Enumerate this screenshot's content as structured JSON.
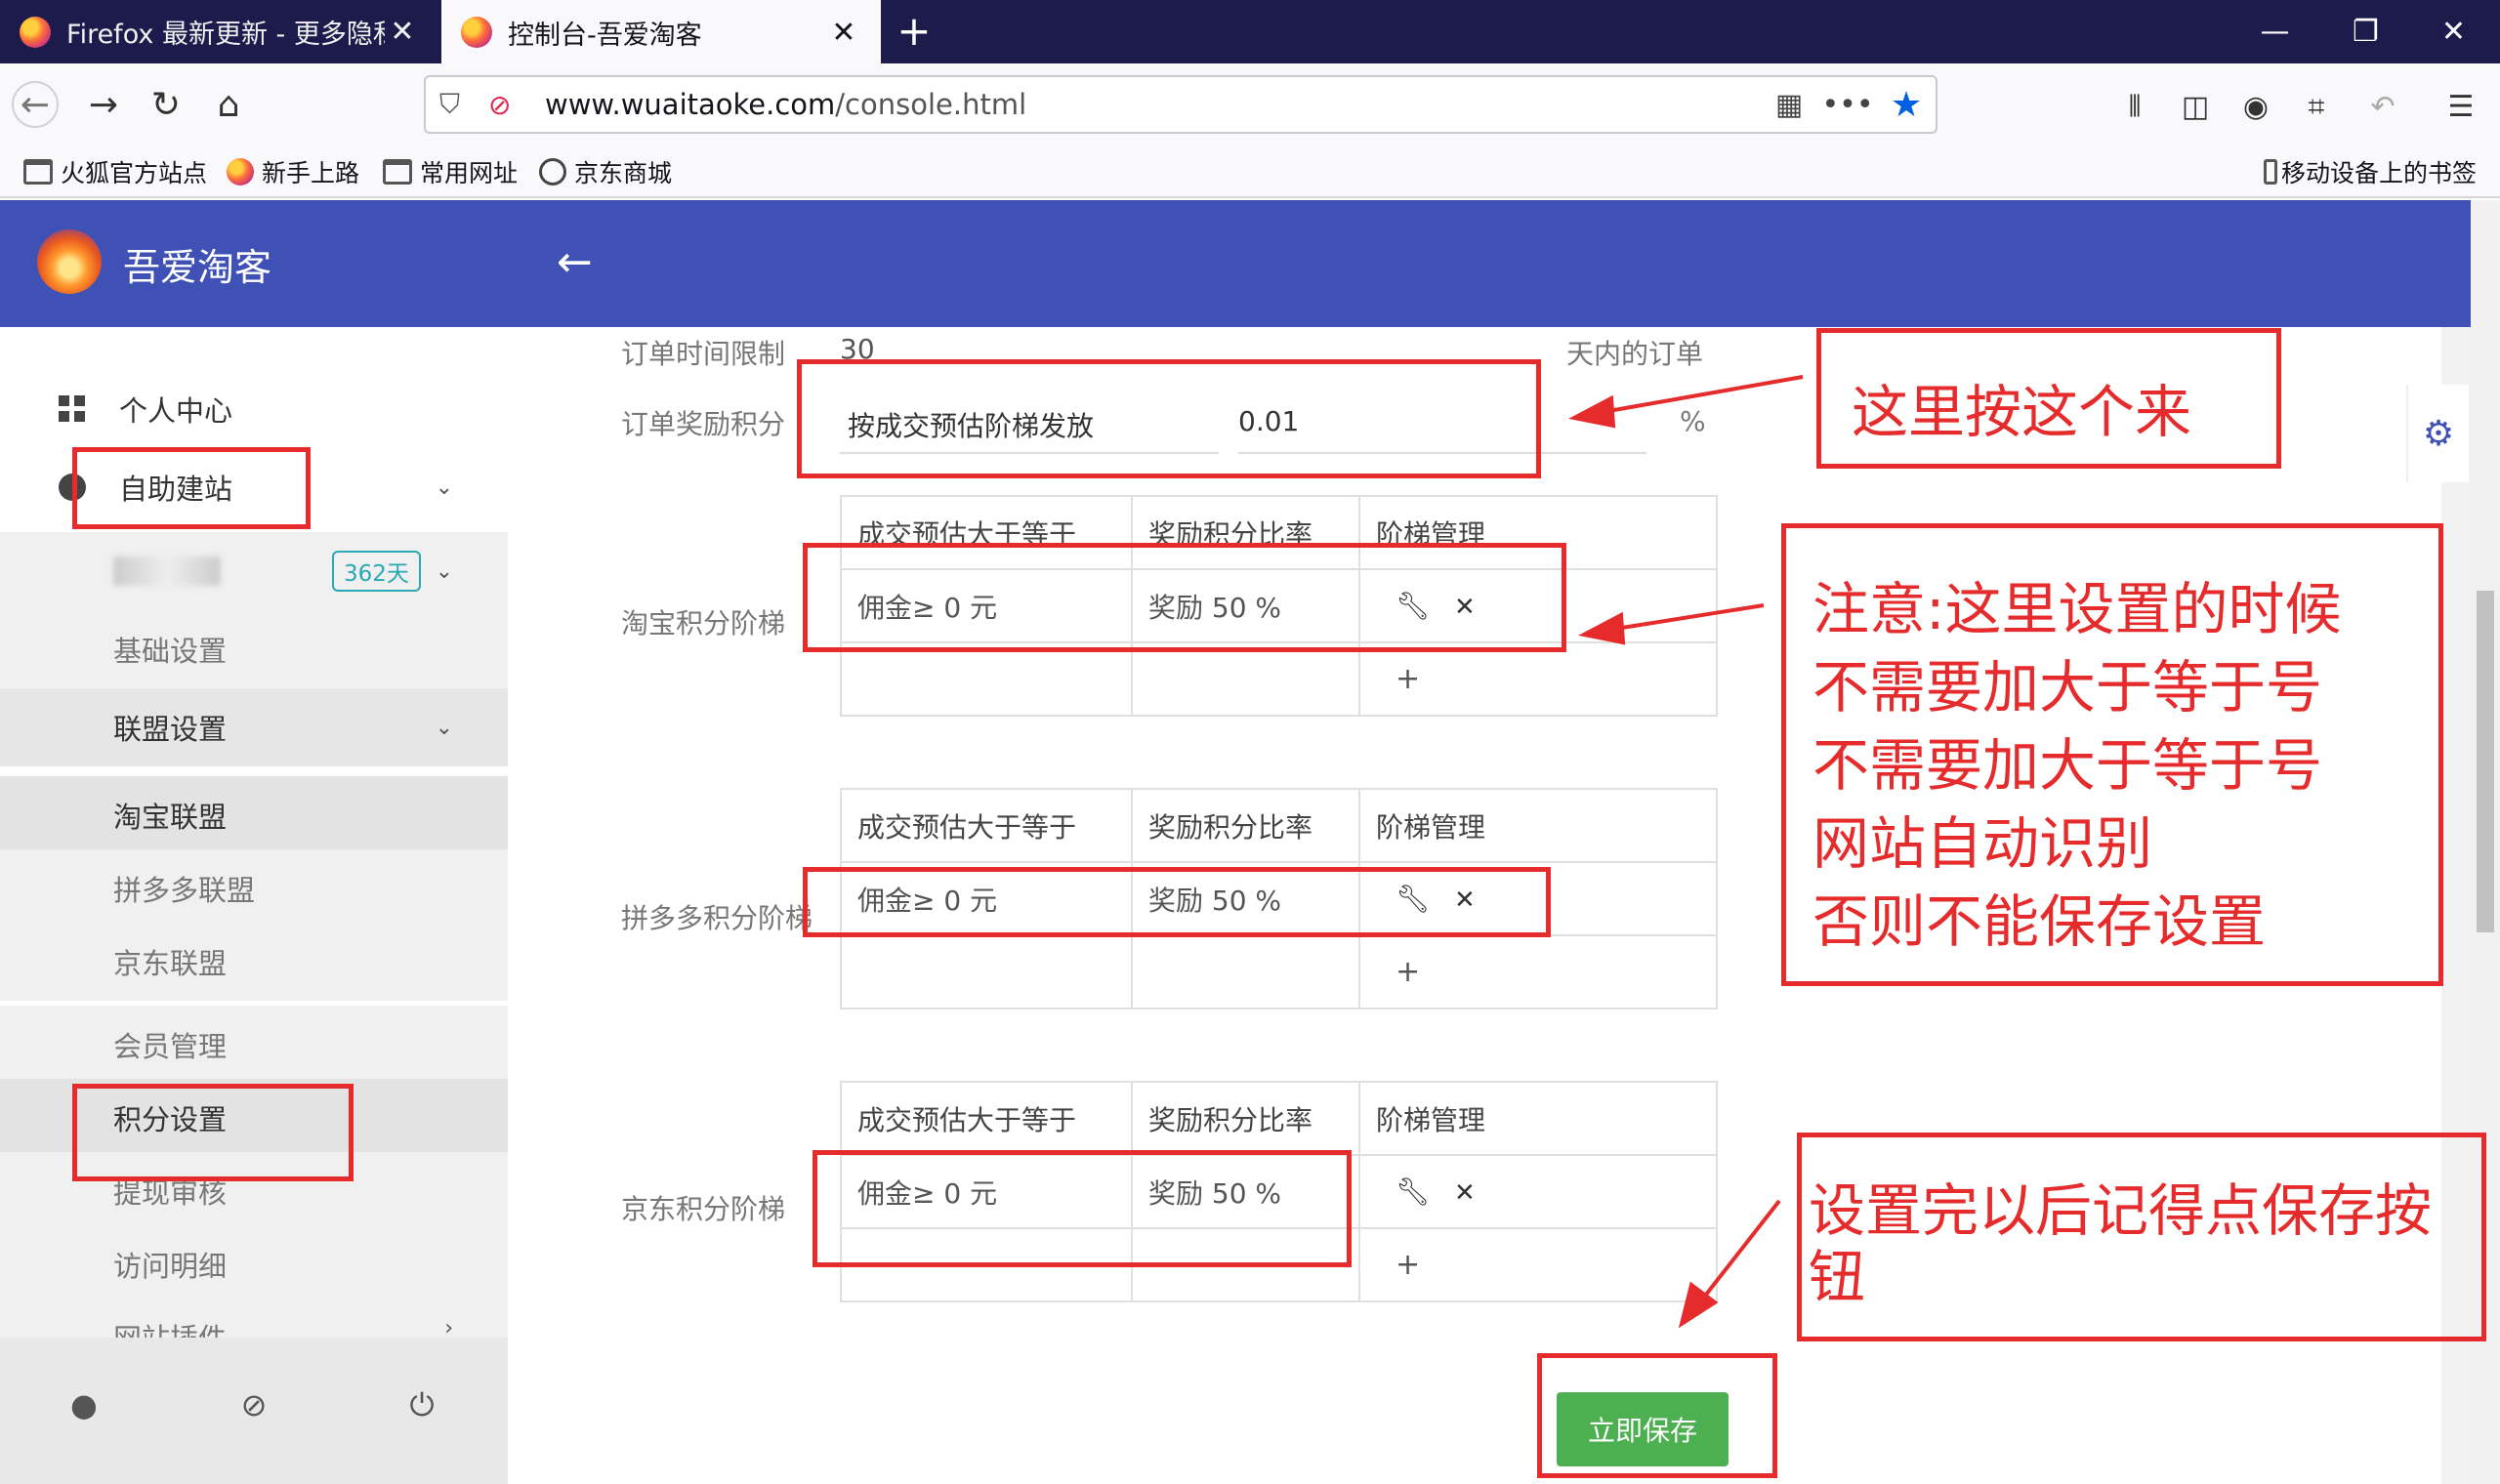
{
  "browser": {
    "tabs": [
      {
        "title": "Firefox 最新更新 - 更多隐私,",
        "active": false
      },
      {
        "title": "控制台-吾爱淘客",
        "active": true
      }
    ],
    "url_domain": "www.wuaitaoke.com",
    "url_path": "/console.html",
    "bookmarks": [
      "火狐官方站点",
      "新手上路",
      "常用网址",
      "京东商城"
    ],
    "mobile_bookmarks": "移动设备上的书签"
  },
  "app": {
    "name": "吾爱淘客",
    "colors": {
      "header": "#3f51b5",
      "save": "#4caf50",
      "annotation": "#e52b2b"
    }
  },
  "sidebar": {
    "personal_center": "个人中心",
    "self_build": "自助建站",
    "site_badge": "362天",
    "basic_settings": "基础设置",
    "alliance_settings": "联盟设置",
    "taobao": "淘宝联盟",
    "pdd": "拼多多联盟",
    "jd": "京东联盟",
    "members": "会员管理",
    "points": "积分设置",
    "withdraw": "提现审核",
    "visits": "访问明细",
    "plugins": "网站插件"
  },
  "form": {
    "order_time_label": "订单时间限制",
    "order_time_value": "30",
    "order_time_suffix": "天内的订单",
    "reward_label": "订单奖励积分",
    "reward_mode": "按成交预估阶梯发放",
    "reward_value": "0.01",
    "reward_unit": "%",
    "table_headers": [
      "成交预估大于等于",
      "奖励积分比率",
      "阶梯管理"
    ],
    "tiers": [
      {
        "label": "淘宝积分阶梯",
        "commission": "佣金≥ 0 元",
        "rate": "奖励 50 %"
      },
      {
        "label": "拼多多积分阶梯",
        "commission": "佣金≥ 0 元",
        "rate": "奖励 50 %"
      },
      {
        "label": "京东积分阶梯",
        "commission": "佣金≥ 0 元",
        "rate": "奖励 50 %"
      }
    ],
    "add_symbol": "+",
    "delete_symbol": "✕",
    "save_label": "立即保存"
  },
  "annotations": {
    "note1": "这里按这个来",
    "note2": [
      "注意:这里设置的时候",
      "不需要加大于等于号",
      "不需要加大于等于号",
      "网站自动识别",
      "否则不能保存设置"
    ],
    "note3": "设置完以后记得点保存按钮"
  }
}
